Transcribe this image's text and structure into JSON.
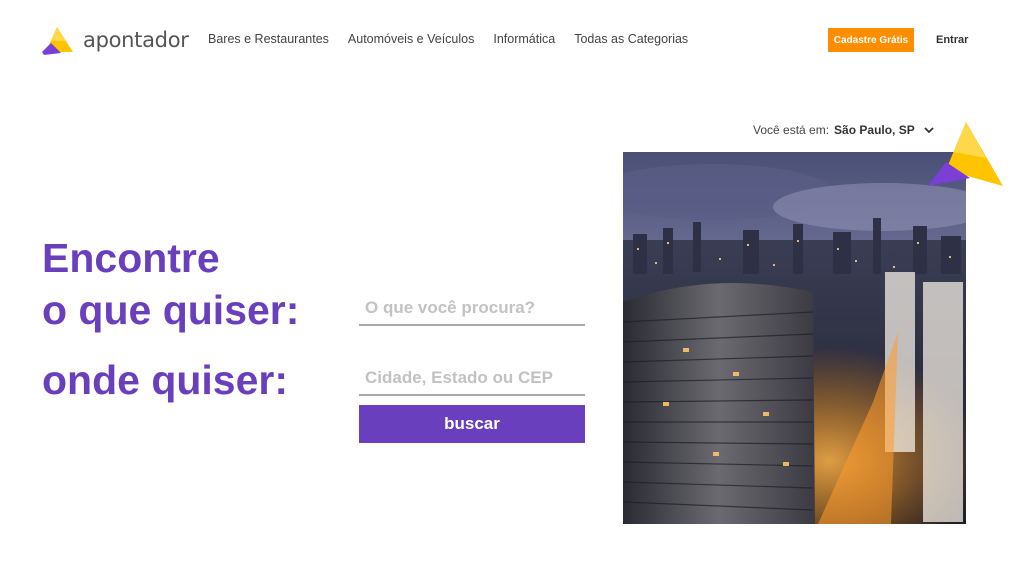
{
  "header": {
    "brand": "apontador",
    "nav": [
      "Bares e Restaurantes",
      "Automóveis e Veículos",
      "Informática",
      "Todas as Categorias"
    ],
    "signup_label": "Cadastre Grátis",
    "login_label": "Entrar"
  },
  "location": {
    "prefix": "Você está em:",
    "city": "São Paulo, SP"
  },
  "hero": {
    "line1": "Encontre",
    "line2": "o que quiser:",
    "line3": "onde quiser:"
  },
  "search": {
    "what_placeholder": "O que você procura?",
    "where_placeholder": "Cidade, Estado ou CEP",
    "button_label": "buscar"
  },
  "colors": {
    "brand_purple": "#6a3fbd",
    "accent_orange": "#ff8d00",
    "logo_yellow": "#ffc400"
  },
  "icons": {
    "logo": "apontador-logo-icon",
    "location_dropdown": "chevron-down-icon"
  }
}
